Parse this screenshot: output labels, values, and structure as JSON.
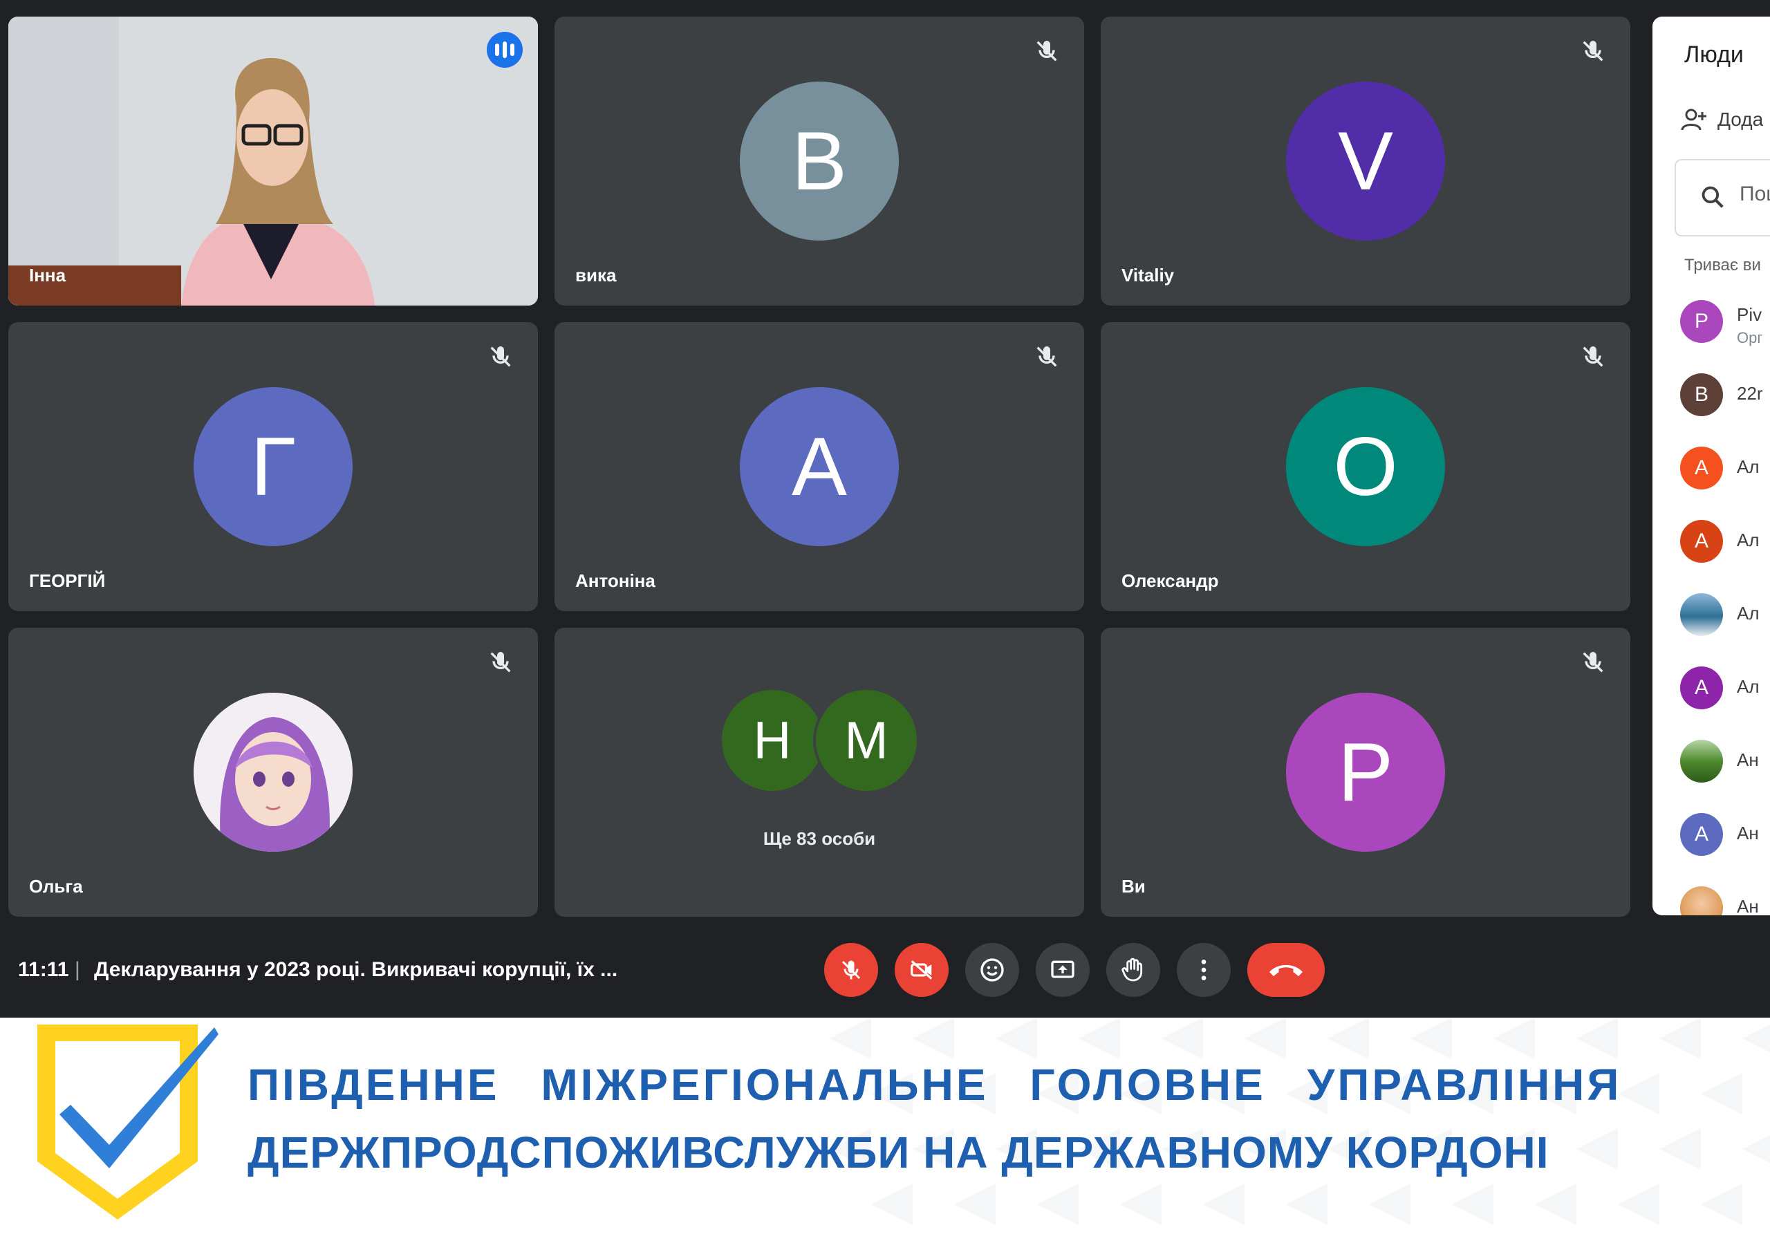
{
  "tiles": [
    {
      "name": "Інна",
      "initial": "",
      "color": "",
      "has_video": true,
      "speaking": true
    },
    {
      "name": "вика",
      "initial": "B",
      "color": "#78909c"
    },
    {
      "name": "Vitaliy",
      "initial": "V",
      "color": "#512da8"
    },
    {
      "name": "ГЕОРГІЙ",
      "initial": "Г",
      "color": "#5c6bc0"
    },
    {
      "name": "Антоніна",
      "initial": "А",
      "color": "#5c6bc0"
    },
    {
      "name": "Олександр",
      "initial": "О",
      "color": "#00897b"
    },
    {
      "name": "Ольга",
      "initial": "",
      "color": "",
      "has_photo": true
    },
    {
      "name": "",
      "group_initials": [
        "Н",
        "М"
      ],
      "group_color": "#33691e",
      "more_text": "Ще 83 особи"
    },
    {
      "name": "Ви",
      "initial": "P",
      "color": "#ab47bc"
    }
  ],
  "people_panel": {
    "title": "Люди",
    "add_label": "Дода",
    "search_placeholder": "Пош",
    "section_label": "Триває ви",
    "participants": [
      {
        "initial": "P",
        "color": "#ab47bc",
        "text": "Piv",
        "sub": "Орг"
      },
      {
        "initial": "B",
        "color": "#5d4037",
        "text": "22r"
      },
      {
        "initial": "А",
        "color": "#f4511e",
        "text": "Ал"
      },
      {
        "initial": "А",
        "color": "#d84315",
        "text": "Ал"
      },
      {
        "initial": "",
        "color": "#4a8fb8",
        "text": "Ал"
      },
      {
        "initial": "А",
        "color": "#8e24aa",
        "text": "Ал"
      },
      {
        "initial": "",
        "color": "#558b2f",
        "text": "Ан"
      },
      {
        "initial": "А",
        "color": "#5c6bc0",
        "text": "Ан"
      },
      {
        "initial": "",
        "color": "#e0a060",
        "text": "Ан"
      }
    ]
  },
  "bottom_bar": {
    "time": "11:11",
    "separator": "|",
    "meeting_title": "Декларування у 2023 році. Викривачі корупції, їх ..."
  },
  "controls": [
    "mic-off-icon",
    "camera-off-icon",
    "emoji-icon",
    "present-screen-icon",
    "raise-hand-icon",
    "more-options-icon",
    "end-call-icon"
  ],
  "banner": {
    "line1": "ПІВДЕННЕ МІЖРЕГІОНАЛЬНЕ ГОЛОВНЕ УПРАВЛІННЯ",
    "line2": "ДЕРЖПРОДСПОЖИВСЛУЖБИ НА ДЕРЖАВНОМУ КОРДОНІ",
    "text_color": "#1f5fb0",
    "shield_color": "#ffd21f",
    "check_color": "#2f7ed8"
  }
}
